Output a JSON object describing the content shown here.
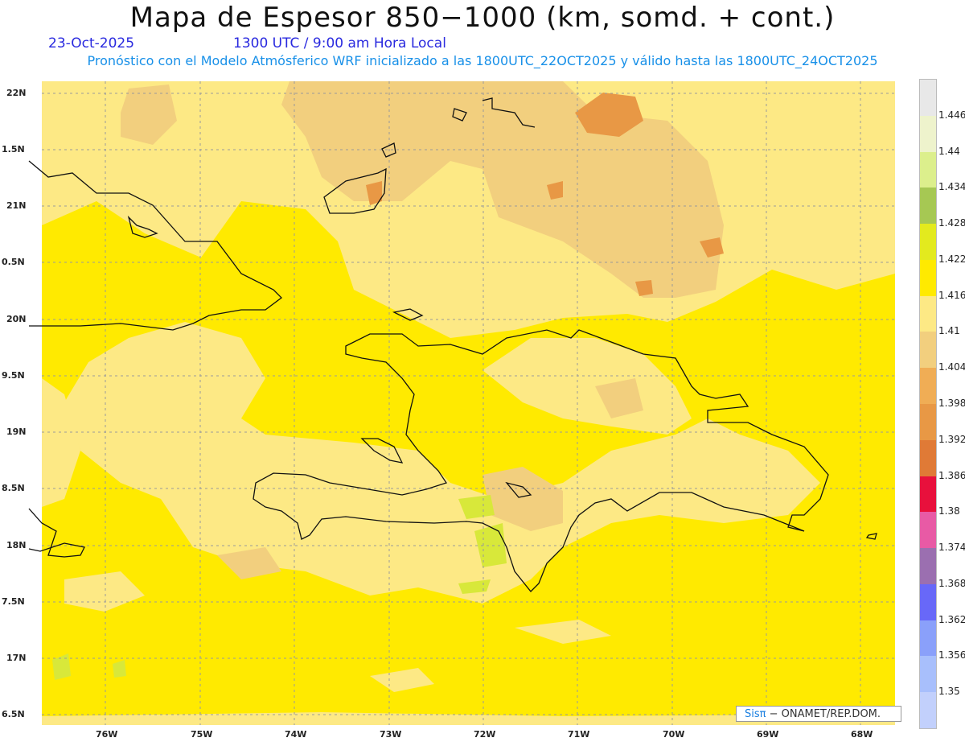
{
  "header": {
    "title": "Mapa de Espesor 850−1000 (km, somd. + cont.)",
    "date": "23-Oct-2025",
    "time": "1300 UTC / 9:00 am Hora Local",
    "forecast": "Pronóstico con el Modelo Atmósferico WRF inicializado a las 1800UTC_22OCT2025 y válido hasta las  1800UTC_24OCT2025"
  },
  "map": {
    "lat_labels": [
      "22N",
      "1.5N",
      "21N",
      "0.5N",
      "20N",
      "9.5N",
      "19N",
      "8.5N",
      "18N",
      "7.5N",
      "17N",
      "6.5N"
    ],
    "lon_labels": [
      "76W",
      "75W",
      "74W",
      "73W",
      "72W",
      "71W",
      "70W",
      "69W",
      "68W"
    ],
    "colors": {
      "ocean_base": "#ffea00",
      "light": "#fde985",
      "tan": "#f2cf7e",
      "orange": "#e89845",
      "lime": "#d8e83a",
      "coast": "#111111"
    }
  },
  "colorbar": {
    "labels": [
      "1.446",
      "1.44",
      "1.434",
      "1.428",
      "1.422",
      "1.416",
      "1.41",
      "1.404",
      "1.398",
      "1.392",
      "1.386",
      "1.38",
      "1.374",
      "1.368",
      "1.362",
      "1.356",
      "1.35"
    ],
    "colors": [
      "#e8e8e8",
      "#eef3cc",
      "#dcef8c",
      "#a6c853",
      "#e3ea1e",
      "#ffea00",
      "#fde985",
      "#f2cf7e",
      "#f0ad55",
      "#e89845",
      "#e07a36",
      "#e8103c",
      "#e85aa5",
      "#9b6fb0",
      "#6868f8",
      "#8aa0fa",
      "#a8bffc",
      "#c2d0fc"
    ]
  },
  "credit": {
    "brand": "Sisπ",
    "text": "− ONAMET/REP.DOM."
  }
}
